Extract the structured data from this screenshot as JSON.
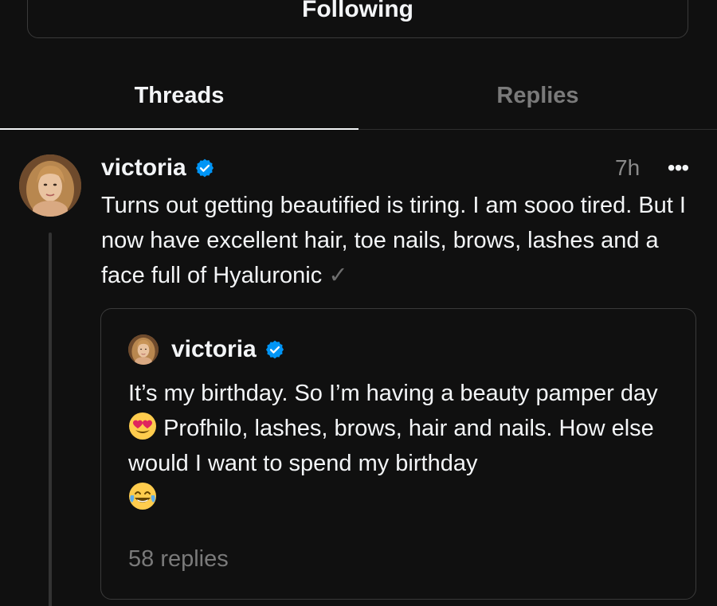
{
  "header": {
    "following_label": "Following"
  },
  "tabs": [
    {
      "label": "Threads",
      "active": true
    },
    {
      "label": "Replies",
      "active": false
    }
  ],
  "post": {
    "username": "victoria",
    "verified": true,
    "time": "7h",
    "more_icon": "more-horizontal-icon",
    "more_label": "•••",
    "text": "Turns out getting beautified is tiring. I am sooo tired. But I now have excellent hair, toe nails, brows, lashes and a face full of Hyaluronic",
    "trailing_glyph": "✓",
    "quote": {
      "username": "victoria",
      "verified": true,
      "text_part1": "It’s my birthday. So I’m having a beauty pamper day",
      "emoji1": "heart-eyes-emoji",
      "text_part2": "Profhilo, lashes, brows, hair and nails. How else would I want to spend my birthday",
      "emoji2": "tears-of-joy-emoji",
      "replies": "58 replies"
    }
  },
  "colors": {
    "background": "#101010",
    "text_primary": "#f3f5f7",
    "text_secondary": "#7a7a7a",
    "verified_blue": "#0095f6",
    "border": "#3a3a3a"
  }
}
